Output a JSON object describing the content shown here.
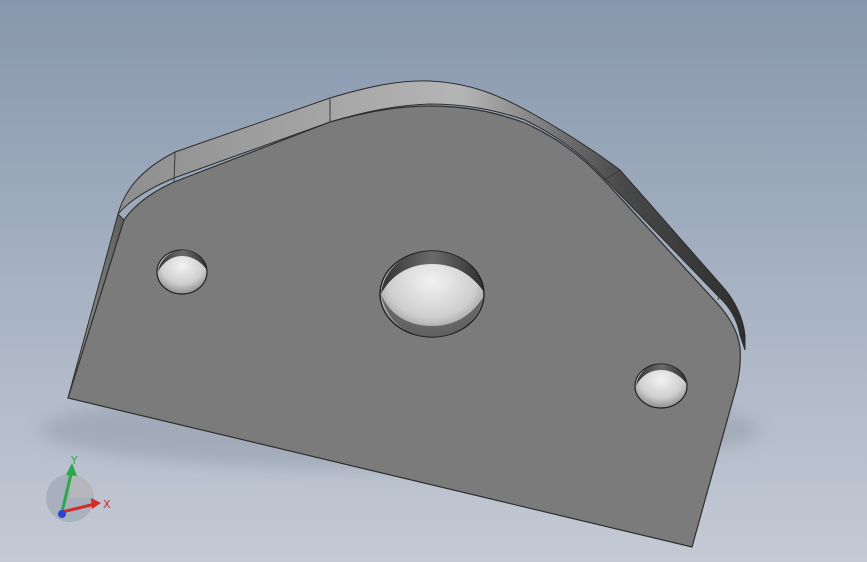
{
  "viewport": {
    "background_top": "#8797ad",
    "background_bottom": "#c4cad5",
    "model_face_color": "#7d7d7d",
    "model_edge_color": "#3a3a3a"
  },
  "triad": {
    "x_label": "X",
    "y_label": "Y",
    "x_color": "#d42a2a",
    "y_color": "#2aa84a",
    "z_color": "#2a44d4"
  }
}
